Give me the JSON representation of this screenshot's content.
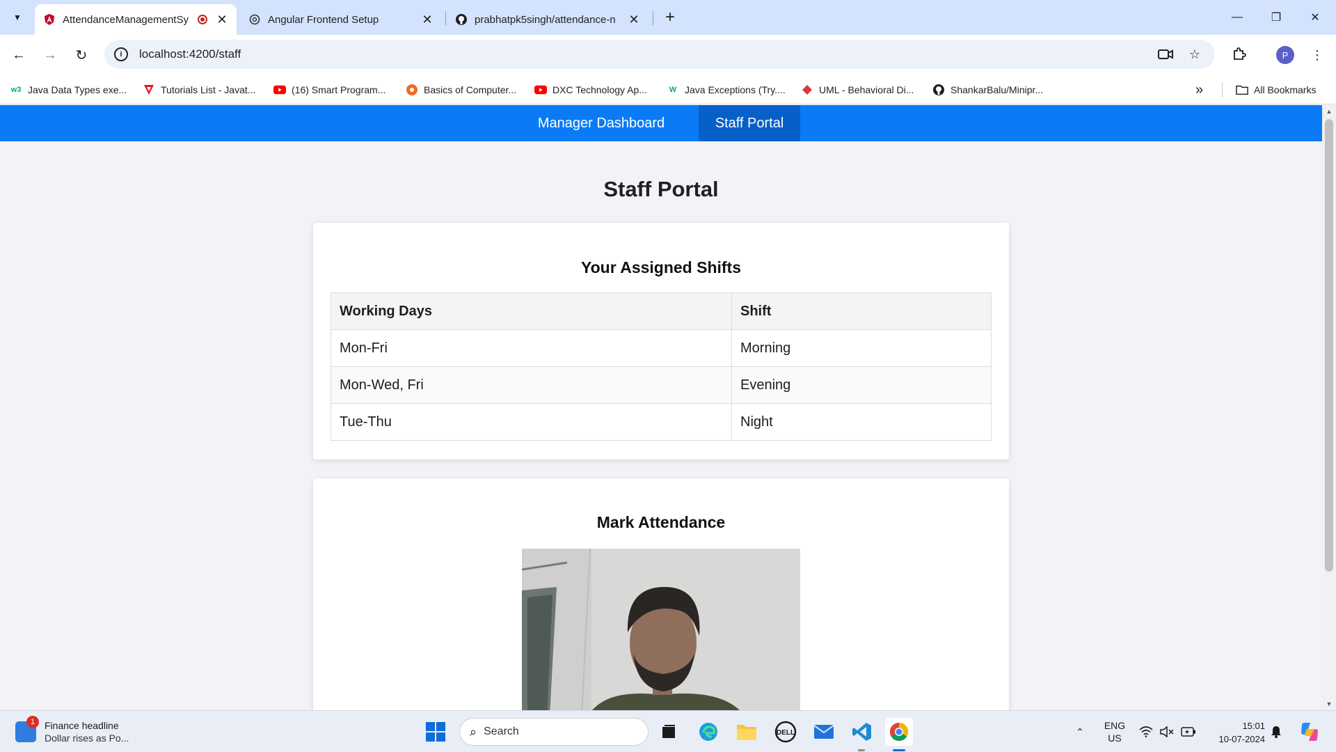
{
  "browser": {
    "tabs": [
      {
        "title": "AttendanceManagementSy",
        "active": true,
        "recording": true
      },
      {
        "title": "Angular Frontend Setup",
        "active": false
      },
      {
        "title": "prabhatpk5singh/attendance-n",
        "active": false
      }
    ],
    "new_tab_label": "+",
    "url": "localhost:4200/staff",
    "profile_initial": "P",
    "bookmarks": [
      {
        "label": "Java Data Types exe...",
        "icon": "w3schools-icon"
      },
      {
        "label": "Tutorials List - Javat...",
        "icon": "javatpoint-icon"
      },
      {
        "label": "(16) Smart Program...",
        "icon": "youtube-icon"
      },
      {
        "label": "Basics of Computer...",
        "icon": "orange-circle-icon"
      },
      {
        "label": "DXC Technology Ap...",
        "icon": "youtube-icon"
      },
      {
        "label": "Java Exceptions (Try....",
        "icon": "w3schools-icon"
      },
      {
        "label": "UML - Behavioral Di...",
        "icon": "red-diamond-icon"
      },
      {
        "label": "ShankarBalu/Minipr...",
        "icon": "github-icon"
      }
    ],
    "more_bookmarks_glyph": "»",
    "all_bookmarks_label": "All Bookmarks"
  },
  "app": {
    "nav": [
      {
        "label": "Manager Dashboard",
        "active": false
      },
      {
        "label": "Staff Portal",
        "active": true
      }
    ],
    "page_title": "Staff Portal",
    "shifts_card": {
      "title": "Your Assigned Shifts",
      "columns": [
        "Working Days",
        "Shift"
      ],
      "rows": [
        [
          "Mon-Fri",
          "Morning"
        ],
        [
          "Mon-Wed, Fri",
          "Evening"
        ],
        [
          "Tue-Thu",
          "Night"
        ]
      ]
    },
    "attendance_card": {
      "title": "Mark Attendance"
    }
  },
  "taskbar": {
    "widget_badge": "1",
    "widget_title": "Finance headline",
    "widget_subtitle": "Dollar rises as Po...",
    "search_label": "Search",
    "lang_line1": "ENG",
    "lang_line2": "US",
    "time": "15:01",
    "date": "10-07-2024"
  },
  "colors": {
    "app_nav_bg": "#0a7bf5",
    "app_nav_active": "#0660c8",
    "page_bg": "#f3f2f7",
    "tabstrip_bg": "#d3e3fd"
  }
}
